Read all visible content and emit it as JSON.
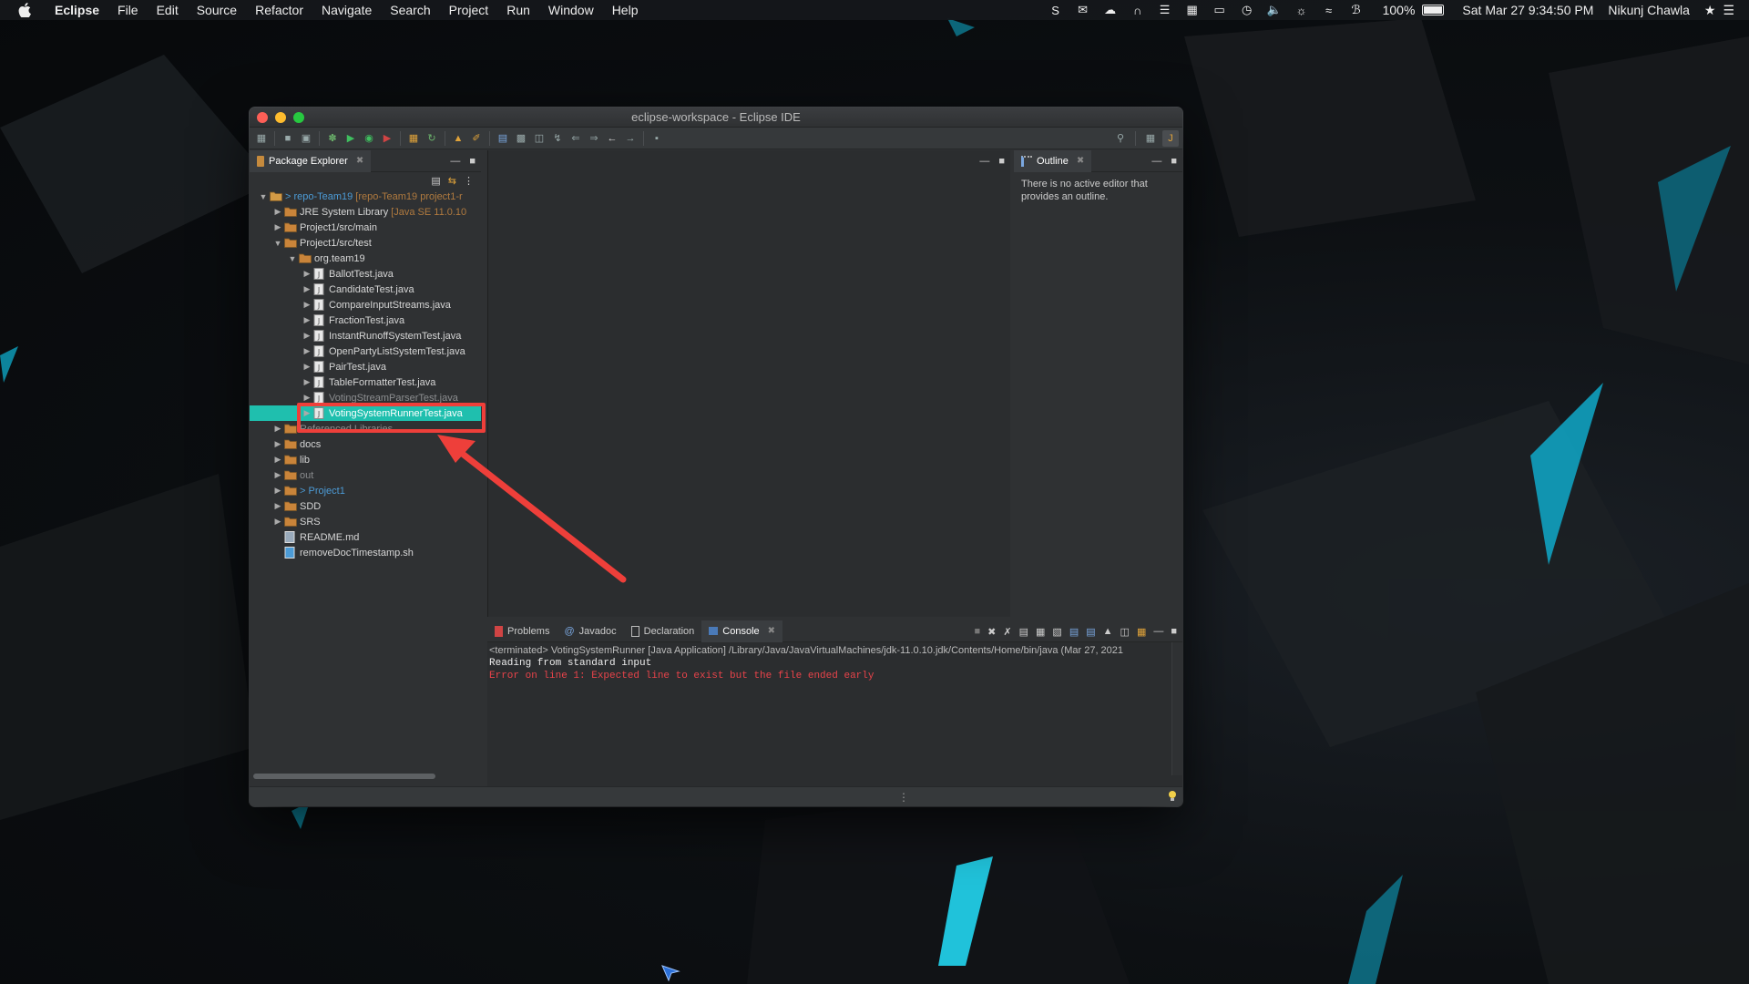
{
  "menubar": {
    "app_name": "Eclipse",
    "menus": [
      "File",
      "Edit",
      "Source",
      "Refactor",
      "Navigate",
      "Search",
      "Project",
      "Run",
      "Window",
      "Help"
    ],
    "battery": "100%",
    "datetime": "Sat Mar 27  9:34:50 PM",
    "user": "Nikunj Chawla"
  },
  "window": {
    "title": "eclipse-workspace - Eclipse IDE"
  },
  "package_explorer": {
    "tab_label": "Package Explorer",
    "tree": [
      {
        "label": "> repo-Team19",
        "deco": "[repo-Team19 project1-r",
        "indent": 0,
        "expanded": true,
        "type": "project",
        "link": true
      },
      {
        "label": "JRE System Library",
        "deco": "[Java SE 11.0.10",
        "indent": 1,
        "expanded": false,
        "type": "library"
      },
      {
        "label": "Project1/src/main",
        "indent": 1,
        "expanded": false,
        "type": "srcfolder"
      },
      {
        "label": "Project1/src/test",
        "indent": 1,
        "expanded": true,
        "type": "srcfolder"
      },
      {
        "label": "org.team19",
        "indent": 2,
        "expanded": true,
        "type": "package"
      },
      {
        "label": "BallotTest.java",
        "indent": 3,
        "expanded": false,
        "type": "java"
      },
      {
        "label": "CandidateTest.java",
        "indent": 3,
        "expanded": false,
        "type": "java"
      },
      {
        "label": "CompareInputStreams.java",
        "indent": 3,
        "expanded": false,
        "type": "java"
      },
      {
        "label": "FractionTest.java",
        "indent": 3,
        "expanded": false,
        "type": "java"
      },
      {
        "label": "InstantRunoffSystemTest.java",
        "indent": 3,
        "expanded": false,
        "type": "java"
      },
      {
        "label": "OpenPartyListSystemTest.java",
        "indent": 3,
        "expanded": false,
        "type": "java"
      },
      {
        "label": "PairTest.java",
        "indent": 3,
        "expanded": false,
        "type": "java"
      },
      {
        "label": "TableFormatterTest.java",
        "indent": 3,
        "expanded": false,
        "type": "java"
      },
      {
        "label": "VotingStreamParserTest.java",
        "indent": 3,
        "expanded": false,
        "type": "java",
        "faded": true
      },
      {
        "label": "VotingSystemRunnerTest.java",
        "indent": 3,
        "expanded": false,
        "type": "java",
        "selected": true
      },
      {
        "label": "Referenced Libraries",
        "indent": 1,
        "expanded": false,
        "type": "library",
        "faded": true
      },
      {
        "label": "docs",
        "indent": 1,
        "expanded": false,
        "type": "folder"
      },
      {
        "label": "lib",
        "indent": 1,
        "expanded": false,
        "type": "folder"
      },
      {
        "label": "out",
        "indent": 1,
        "expanded": false,
        "type": "folder",
        "dim": true
      },
      {
        "label": "> Project1",
        "indent": 1,
        "expanded": false,
        "type": "folder",
        "link": true
      },
      {
        "label": "SDD",
        "indent": 1,
        "expanded": false,
        "type": "folder"
      },
      {
        "label": "SRS",
        "indent": 1,
        "expanded": false,
        "type": "folder"
      },
      {
        "label": "README.md",
        "indent": 1,
        "type": "file"
      },
      {
        "label": "removeDocTimestamp.sh",
        "indent": 1,
        "type": "script"
      }
    ]
  },
  "outline": {
    "tab_label": "Outline",
    "message": "There is no active editor that provides an outline."
  },
  "console": {
    "tabs": [
      "Problems",
      "Javadoc",
      "Declaration",
      "Console"
    ],
    "active_tab": "Console",
    "terminated_line": "<terminated> VotingSystemRunner [Java Application] /Library/Java/JavaVirtualMachines/jdk-11.0.10.jdk/Contents/Home/bin/java  (Mar 27, 2021",
    "output_line": "Reading from standard input",
    "error_line": "Error on line 1: Expected line to exist but the file ended early"
  },
  "colors": {
    "selection": "#1fbfae",
    "annotation": "#ee3f3a",
    "error_text": "#e8434a"
  }
}
